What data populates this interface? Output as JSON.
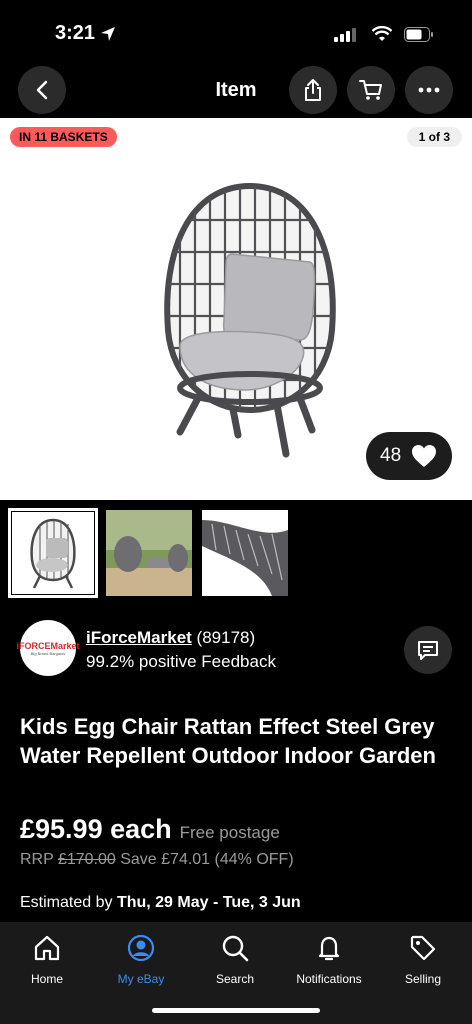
{
  "status": {
    "time": "3:21"
  },
  "header": {
    "title": "Item"
  },
  "hero": {
    "badge": "IN 11 BASKETS",
    "counter": "1 of 3",
    "likes": "48"
  },
  "seller": {
    "logo_text": "iFORCEMarket",
    "logo_sub": "Big Brand Bargains",
    "name": "iForceMarket",
    "score": " (89178)",
    "feedback": "99.2% positive Feedback"
  },
  "product": {
    "title": "Kids Egg Chair Rattan Effect Steel Grey Water Repellent Outdoor Indoor Garden",
    "price": "£95.99 each",
    "postage": "Free postage",
    "rrp_label": "RRP ",
    "rrp_value": "£170.00",
    "saving": " Save £74.01 (44% OFF)",
    "est_label": "Estimated by ",
    "est_dates": "Thu, 29 May - Tue, 3 Jun"
  },
  "tabs": [
    {
      "label": "Home",
      "icon": "home-icon"
    },
    {
      "label": "My eBay",
      "icon": "user-icon"
    },
    {
      "label": "Search",
      "icon": "search-icon"
    },
    {
      "label": "Notifications",
      "icon": "bell-icon"
    },
    {
      "label": "Selling",
      "icon": "tag-icon"
    }
  ],
  "colors": {
    "accent": "#3b8cf2",
    "badge": "#ff5a5a"
  }
}
